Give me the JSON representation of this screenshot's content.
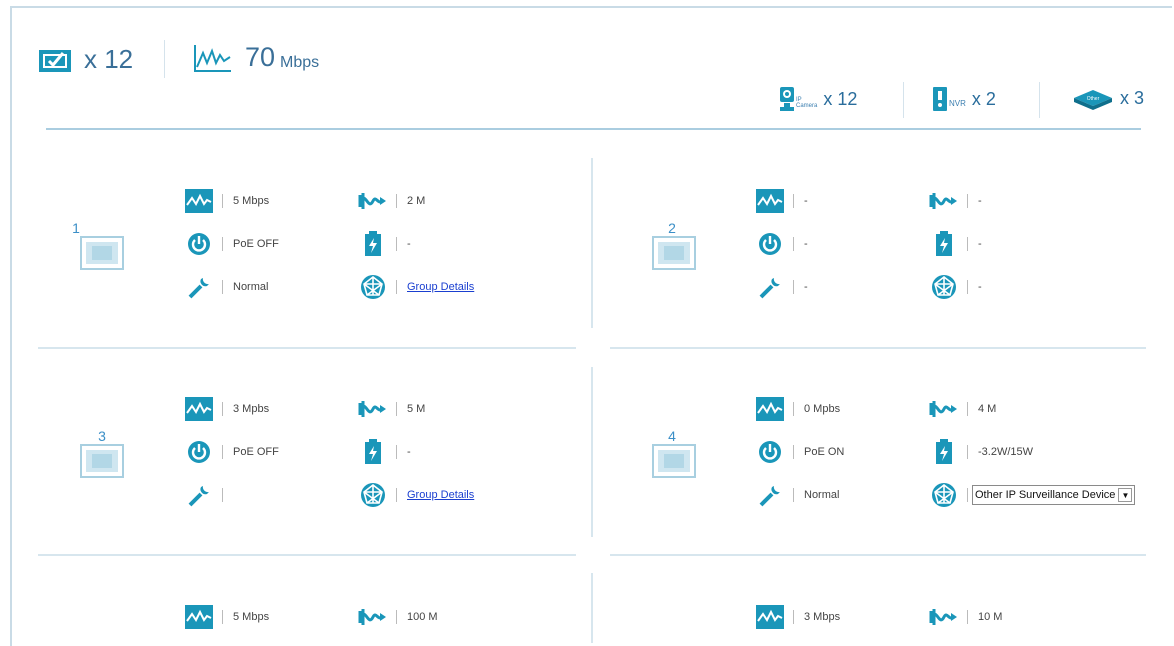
{
  "summary": {
    "port_count": "x 12",
    "rate_value": "70",
    "rate_unit": "Mbps"
  },
  "devices": {
    "ip_camera_label_1": "IP",
    "ip_camera_label_2": "Camera",
    "ip_camera_count": "x 12",
    "nvr_label": "NVR",
    "nvr_count": "x 2",
    "other_label": "Other",
    "other_count": "x 3"
  },
  "colors": {
    "accent": "#1e8fb6",
    "icon": "#1a96b9",
    "link": "#1a3fd0"
  },
  "ports": [
    {
      "id": "1",
      "rate": "5 Mbps",
      "poe": "PoE OFF",
      "status": "Normal",
      "traffic": "2 M",
      "power": "-",
      "device": "Group Details",
      "device_type": "link"
    },
    {
      "id": "2",
      "rate": "-",
      "poe": "-",
      "status": "-",
      "traffic": "-",
      "power": "-",
      "device": "-",
      "device_type": "text"
    },
    {
      "id": "3",
      "rate": "3 Mpbs",
      "poe": "PoE OFF",
      "status": "",
      "traffic": "5 M",
      "power": "-",
      "device": "Group Details",
      "device_type": "link"
    },
    {
      "id": "4",
      "rate": "0 Mpbs",
      "poe": "PoE ON",
      "status": "Normal",
      "traffic": "4 M",
      "power": "-3.2W/15W",
      "device": "Other IP Surveillance Device",
      "device_type": "select"
    },
    {
      "rate": "5 Mbps",
      "traffic": "100 M"
    },
    {
      "rate": "3 Mbps",
      "traffic": "10 M"
    }
  ]
}
